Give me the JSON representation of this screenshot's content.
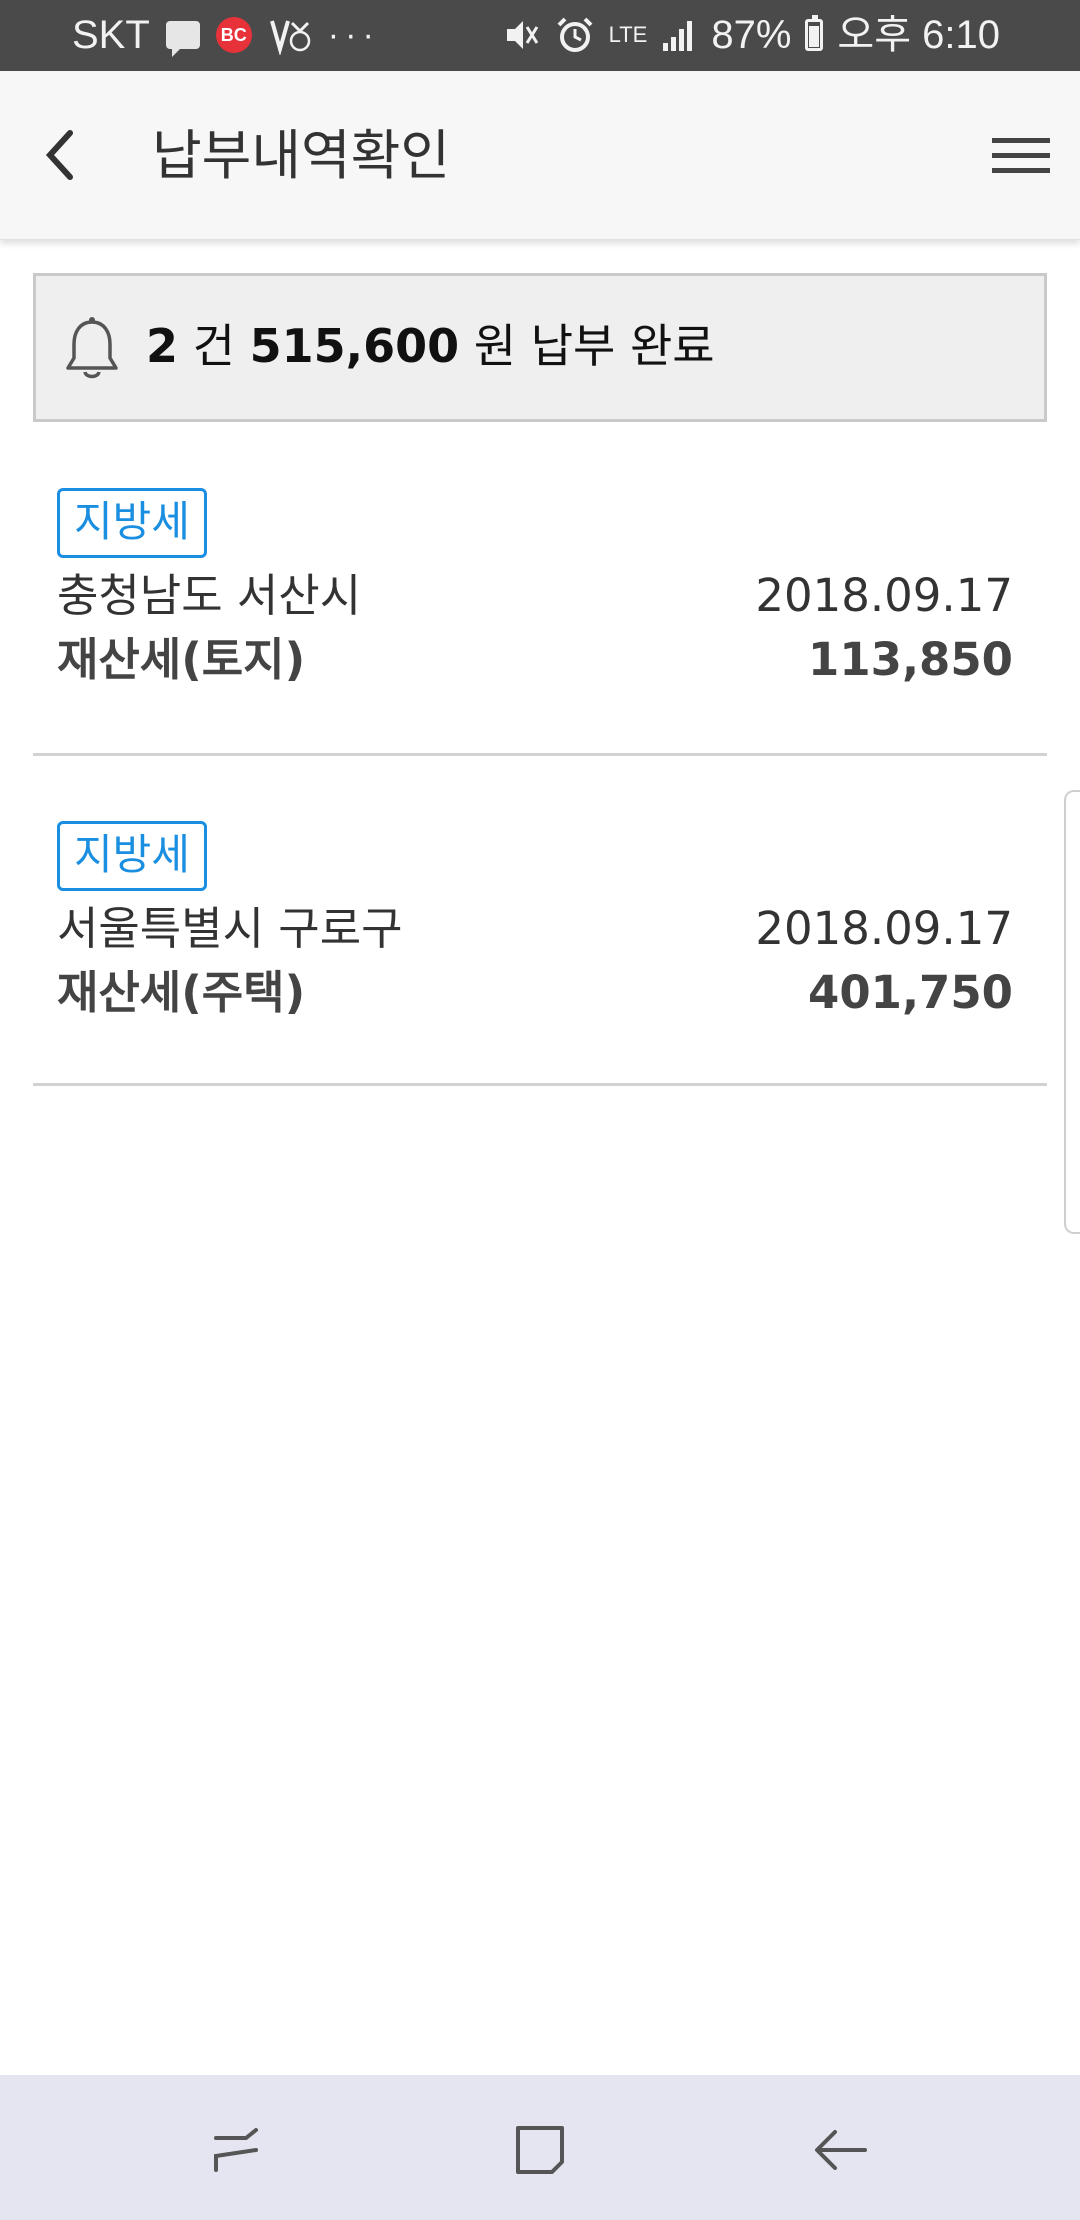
{
  "status_bar": {
    "carrier": "SKT",
    "badge_text": "BC",
    "dots": "···",
    "lte": "LTE",
    "battery": "87%",
    "time": "오후 6:10"
  },
  "header": {
    "title": "납부내역확인"
  },
  "summary": {
    "count": "2",
    "count_unit": "건",
    "amount": "515,600",
    "amount_unit": "원",
    "status": "납부 완료"
  },
  "payments": [
    {
      "tag": "지방세",
      "region": "충청남도 서산시",
      "date": "2018.09.17",
      "tax_name": "재산세(토지)",
      "amount": "113,850"
    },
    {
      "tag": "지방세",
      "region": "서울특별시 구로구",
      "date": "2018.09.17",
      "tax_name": "재산세(주택)",
      "amount": "401,750"
    }
  ],
  "colors": {
    "accent": "#1a8ee0",
    "status_bar": "#4a4a4a",
    "nav_bar": "#e4e5f0"
  },
  "icons": {
    "back": "chevron-left-icon",
    "menu": "hamburger-menu-icon",
    "bell": "bell-icon",
    "nav_recent": "recent-apps-icon",
    "nav_home": "home-icon",
    "nav_back": "back-arrow-icon"
  }
}
